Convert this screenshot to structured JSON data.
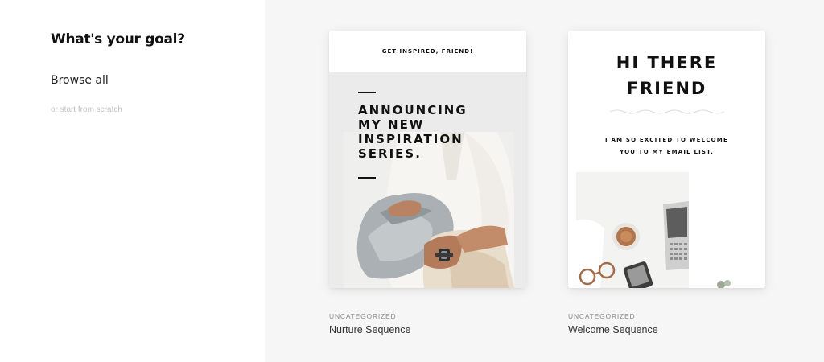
{
  "sidebar": {
    "title": "What's your goal?",
    "browse_all": "Browse all",
    "start_scratch": "or start from scratch"
  },
  "templates": [
    {
      "category": "UNCATEGORIZED",
      "name": "Nurture Sequence",
      "preview_header": "GET INSPIRED, FRIEND!",
      "preview_headline": [
        "ANNOUNCING",
        "MY NEW",
        "INSPIRATION",
        "SERIES."
      ]
    },
    {
      "category": "UNCATEGORIZED",
      "name": "Welcome Sequence",
      "preview_title": [
        "HI THERE",
        "FRIEND"
      ],
      "preview_subtitle": [
        "I AM SO EXCITED TO WELCOME",
        "YOU TO MY EMAIL LIST."
      ]
    }
  ],
  "colors": {
    "main_background": "#f6f6f6",
    "sidebar_background": "#ffffff",
    "card_background": "#ffffff",
    "category_text": "#8a8a8a",
    "muted_link": "#c4c4c4"
  }
}
